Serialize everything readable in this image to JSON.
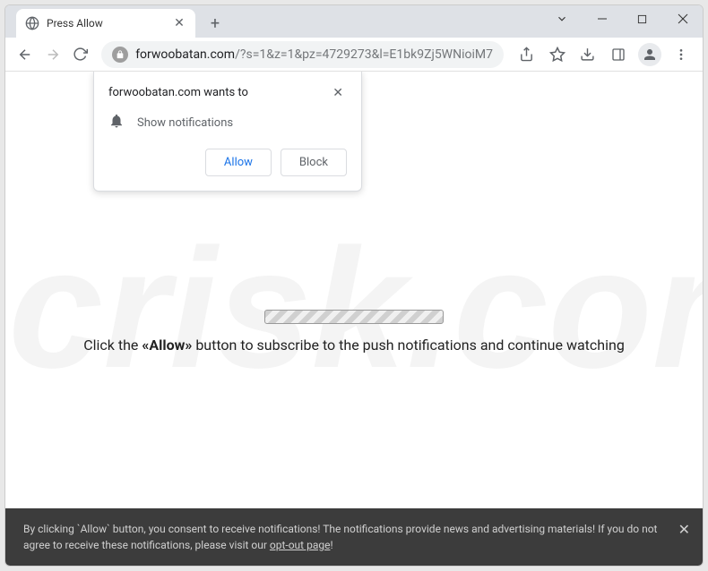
{
  "tab": {
    "title": "Press Allow"
  },
  "url": {
    "domain": "forwoobatan.com",
    "path": "/?s=1&z=1&pz=4729273&l=E1bk9Zj5WNioiM7"
  },
  "popup": {
    "title": "forwoobatan.com wants to",
    "permission_text": "Show notifications",
    "allow_label": "Allow",
    "block_label": "Block"
  },
  "page": {
    "instruction_prefix": "Click the ",
    "instruction_bold": "«Allow»",
    "instruction_suffix": " button to subscribe to the push notifications and continue watching"
  },
  "consent": {
    "text": "By clicking `Allow` button, you consent to receive notifications! The notifications provide news and advertising materials! If you do not agree to receive these notifications, please visit our ",
    "link_text": "opt-out page",
    "suffix": "!"
  },
  "watermark": "pcrisk.com"
}
